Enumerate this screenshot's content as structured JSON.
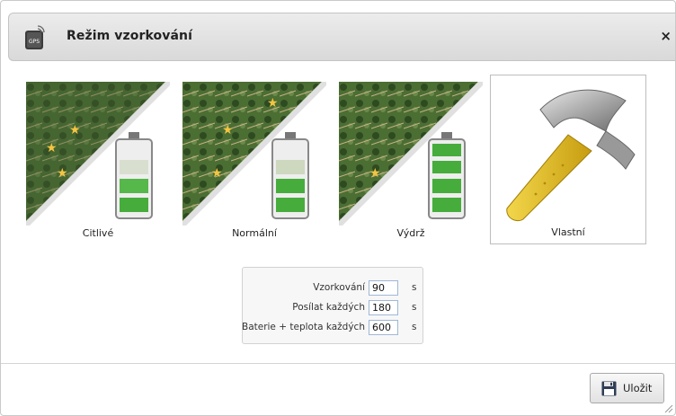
{
  "dialog": {
    "title": "Režim vzorkování",
    "close_label": "×",
    "icon_text": "GPS"
  },
  "modes": [
    {
      "label": "Citlivé",
      "battery_level": 0.33
    },
    {
      "label": "Normální",
      "battery_level": 0.5
    },
    {
      "label": "Výdrž",
      "battery_level": 1.0
    },
    {
      "label": "Vlastní"
    }
  ],
  "settings": {
    "rows": [
      {
        "label": "Vzorkování",
        "value": "90",
        "unit": "s"
      },
      {
        "label": "Posílat každých",
        "value": "180",
        "unit": "s"
      },
      {
        "label": "Baterie + teplota každých",
        "value": "600",
        "unit": "s"
      }
    ]
  },
  "footer": {
    "save_label": "Uložit"
  },
  "colors": {
    "accent": "#4a8fd8",
    "battery_green": "#3fae3a",
    "header_bg": "#e2e2e2"
  }
}
